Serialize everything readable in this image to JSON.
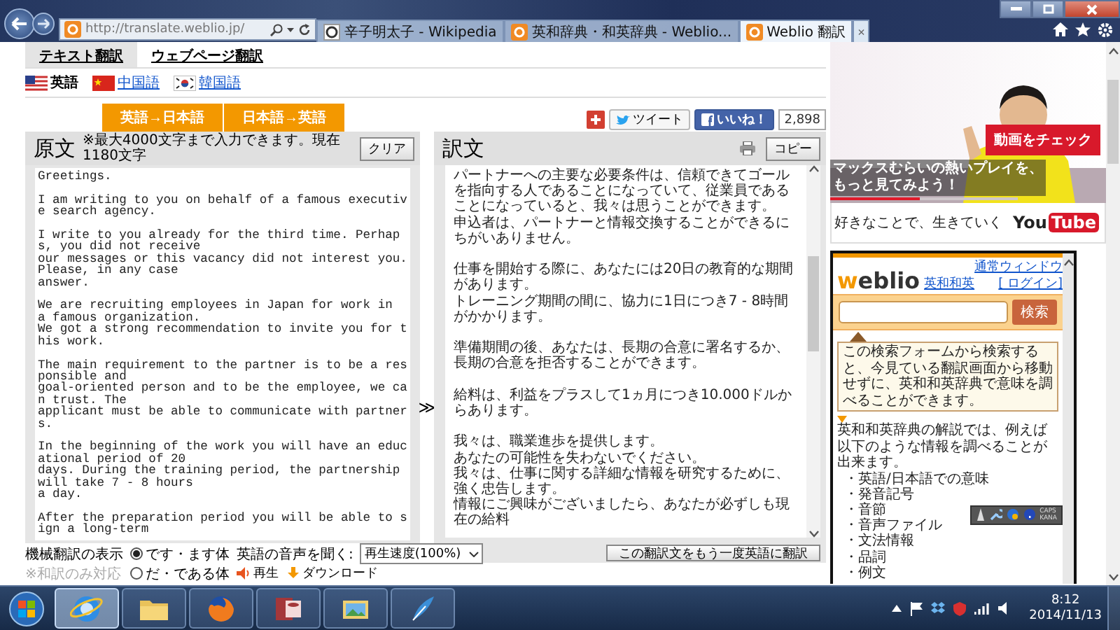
{
  "browser": {
    "address": "http://translate.weblio.jp/",
    "tab_close": "×",
    "tabs": [
      {
        "title": "辛子明太子 - Wikipedia",
        "kind": "wiki",
        "selected": false
      },
      {
        "title": "英和辞典・和英辞典 - Weblio...",
        "kind": "weblio",
        "selected": false
      },
      {
        "title": "Weblio 翻訳",
        "kind": "weblio",
        "selected": true
      }
    ]
  },
  "mode_tabs": [
    {
      "label": "テキスト翻訳",
      "selected": true
    },
    {
      "label": "ウェブページ翻訳",
      "selected": false
    }
  ],
  "languages": [
    {
      "label": "英語",
      "kind": "us",
      "selected": true
    },
    {
      "label": "中国語",
      "kind": "cn",
      "selected": false
    },
    {
      "label": "韓国語",
      "kind": "kr",
      "selected": false
    }
  ],
  "directions": [
    "英語→日本語",
    "日本語→英語"
  ],
  "social": {
    "tweet": "ツイート",
    "like": "いいね！",
    "like_count": "2,898"
  },
  "source": {
    "title": "原文",
    "note": "※最大4000文字まで入力できます。現在1180文字",
    "clear": "クリア",
    "paragraphs": [
      [
        "Greetings."
      ],
      [
        "I am writing to you on behalf of a famous executive search agency."
      ],
      [
        "I write to you already for the third time. Perhaps, you did not receive",
        "our messages or this vacancy did not interest you. Please, in any case",
        "answer."
      ],
      [
        "We are recruiting employees in Japan for work in",
        "a famous organization.",
        "We got a strong recommendation to invite you for this work."
      ],
      [
        "The main requirement to the partner is to be a responsible and",
        "goal-oriented person and to be the employee, we can trust. The",
        "applicant must be able to communicate with partners."
      ],
      [
        "In the beginning of the work you will have an educational period of 20",
        "days. During the training period, the partnership will take 7 - 8 hours",
        "a day."
      ],
      [
        "After the preparation period you will be able to sign a long-term"
      ]
    ]
  },
  "arrow": "≫",
  "target": {
    "title": "訳文",
    "copy": "コピー",
    "retranslate": "この翻訳文をもう一度英語に翻訳",
    "paragraphs": [
      [
        "パートナーへの主要な必要条件は、信頼できてゴールを指向する人であることになっていて、従業員であることになっていると、我々は思うことができます。",
        "申込者は、パートナーと情報交換することができるにちがいありません。"
      ],
      [
        "仕事を開始する際に、あなたには20日の教育的な期間があります。",
        "トレーニング期間の間に、協力に1日につき7 - 8時間がかかります。"
      ],
      [
        "準備期間の後、あなたは、長期の合意に署名するか、長期の合意を拒否することができます。"
      ],
      [
        "給料は、利益をプラスして1ヵ月につき10.000ドルからあります。"
      ],
      [
        "我々は、職業進歩を提供します。",
        "あなたの可能性を失わないでください。",
        "我々は、仕事に関する詳細な情報を研究するために、強く忠告します。",
        "情報にご興味がございましたら、あなたが必ずしも現在の給料"
      ]
    ]
  },
  "options": {
    "label": "機械翻訳の表示",
    "note": "※和訳のみ対応",
    "styles": [
      {
        "label": "です・ます体",
        "selected": true
      },
      {
        "label": "だ・である体",
        "selected": false
      }
    ],
    "audio_label": "英語の音声を聞く:",
    "play": "再生",
    "download": "ダウンロード",
    "speed": "再生速度(100%)"
  },
  "ad": {
    "kind": "picture",
    "message": [
      "マックスむらいの熱いプレイを、",
      "もっと見てみよう！"
    ],
    "cta": "動画をチェック",
    "tagline": "好きなことで、生きていく",
    "brand": [
      "You",
      "Tube"
    ]
  },
  "widget": {
    "logo": [
      "w",
      "eblio"
    ],
    "dict_link": "英和和英",
    "window_link": "通常ウィンドウ",
    "login": "[ ログイン]",
    "search_button": "検索",
    "tip": "この検索フォームから検索すると、今見ている翻訳画面から移動せずに、英和和英辞典で意味を調べることができます。",
    "intro": "英和和英辞典の解説では、例えば以下のような情報を調べることが出来ます。",
    "items": [
      "・英語/日本語での意味",
      "・発音記号",
      "・音節",
      "・音声ファイル",
      "・文法情報",
      "・品詞",
      "・例文"
    ]
  },
  "ime_bar": {
    "caps": "CAPS",
    "kana": "KANA"
  },
  "taskbar": {
    "apps": [
      {
        "kind": "ie",
        "selected": true
      },
      {
        "kind": "folder",
        "selected": false
      },
      {
        "kind": "firefox",
        "selected": false
      },
      {
        "kind": "access",
        "selected": false
      },
      {
        "kind": "photos",
        "selected": false
      },
      {
        "kind": "pen",
        "selected": false
      }
    ],
    "time": "8:12",
    "date": "2014/11/13"
  }
}
